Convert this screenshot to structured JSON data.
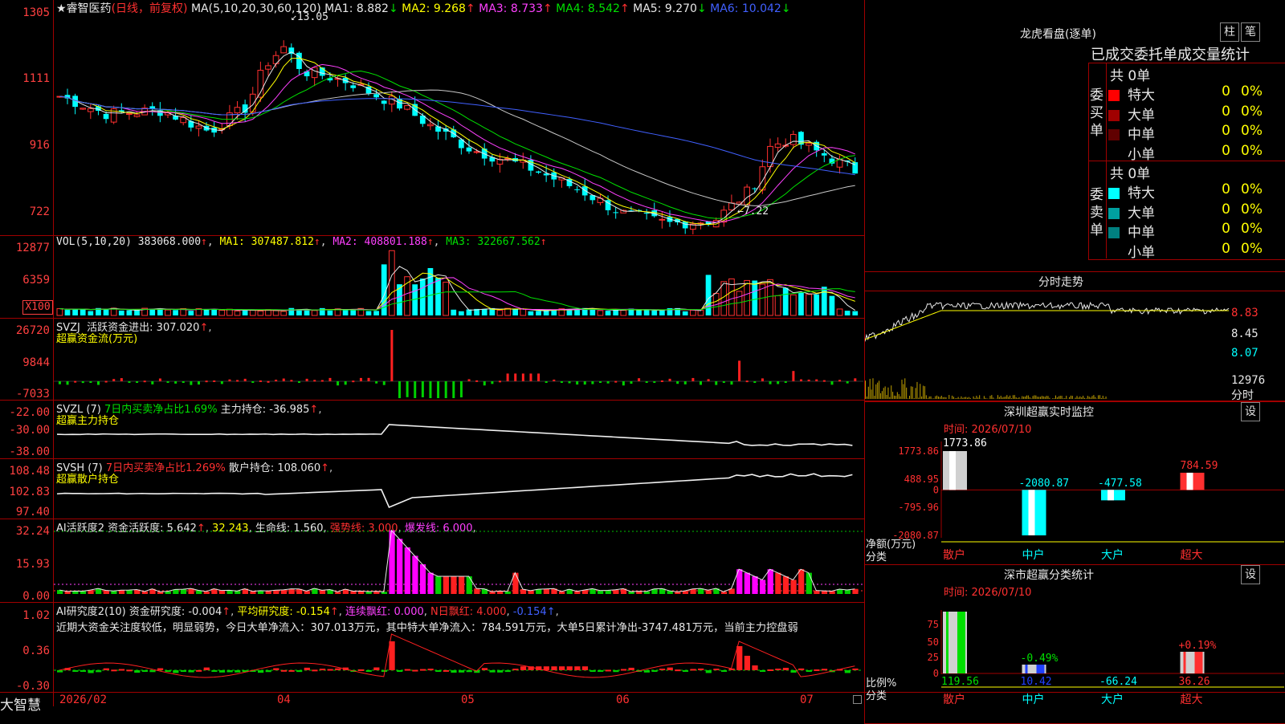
{
  "stock": {
    "name": "睿智医药",
    "mode": "(日线，前复权)",
    "ma_params": "MA(5,10,20,30,60,120)",
    "ma_vals": [
      {
        "label": "MA1: 8.882",
        "arrow": "↓",
        "color": "#e8e8e8"
      },
      {
        "label": "MA2: 9.268",
        "arrow": "↑",
        "color": "#ffff00"
      },
      {
        "label": "MA3: 8.733",
        "arrow": "↑",
        "color": "#ff40ff"
      },
      {
        "label": "MA4: 8.542",
        "arrow": "↑",
        "color": "#00e000"
      },
      {
        "label": "MA5: 9.270",
        "arrow": "↓",
        "color": "#e8e8e8"
      },
      {
        "label": "MA6: 10.042",
        "arrow": "↓",
        "color": "#4060ff"
      }
    ],
    "high_mark": "13.05",
    "low_mark": "7.22"
  },
  "price_axis": [
    "1305",
    "1111",
    "916",
    "722"
  ],
  "vol": {
    "title": "VOL(5,10,20)",
    "value": "383068.000",
    "ma1": "MA1: 307487.812",
    "ma2": "MA2: 408801.188",
    "ma3": "MA3: 322667.562",
    "axis": [
      "12877",
      "6359"
    ],
    "unit": "X100"
  },
  "svzj": {
    "title": "SVZJ",
    "label": "活跃资金进出: 307.020",
    "sub": "超赢资金流(万元)",
    "axis": [
      "26720",
      "9844",
      "-7033"
    ]
  },
  "svzl": {
    "title": "SVZL (7)",
    "label1": "7日内买卖净占比1.69%",
    "label2": "主力持仓: -36.985",
    "sub": "超赢主力持仓",
    "axis": [
      "-22.00",
      "-30.00",
      "-38.00"
    ]
  },
  "svsh": {
    "title": "SVSH (7)",
    "label1": "7日内买卖净占比1.269%",
    "label2": "散户持仓: 108.060",
    "sub": "超赢散户持仓",
    "axis": [
      "108.48",
      "102.83",
      "97.40"
    ]
  },
  "ai1": {
    "title": "AI活跃度2",
    "l1": "资金活跃度: 5.642",
    "l2": "32.243",
    "l3": "生命线: 1.560",
    "l4": "强势线: 3.000",
    "l5": "爆发线: 6.000",
    "axis": [
      "32.24",
      "15.93",
      "0.00"
    ]
  },
  "ai2": {
    "title": "AI研究度2(10)",
    "l1": "资金研究度: -0.004",
    "l2": "平均研究度: -0.154",
    "l3": "连续飘红: 0.000",
    "l4": "N日飘红: 4.000",
    "l5": "-0.154",
    "commentary": "近期大资金关注度较低，明显弱势，今日大单净流入：307.013万元，其中特大单净流入：784.591万元，大单5日累计净出-3747.481万元，当前主力控盘弱",
    "axis": [
      "1.02",
      "0.36",
      "-0.30"
    ]
  },
  "xaxis": [
    "2026/02",
    "04",
    "05",
    "06",
    "07"
  ],
  "brand": "大智慧",
  "longhu": {
    "title": "龙虎看盘(逐单)",
    "btn1": "柱",
    "btn2": "笔",
    "tabs": "已成交委托单成交量统计",
    "buy_label": "委买单",
    "sell_label": "委卖单",
    "buy_total": "共 0单",
    "sell_total": "共 0单",
    "buy_rows": [
      {
        "name": "特大",
        "val": "0",
        "pct": "0%",
        "color": "#ff0000"
      },
      {
        "name": "大单",
        "val": "0",
        "pct": "0%",
        "color": "#a00000"
      },
      {
        "name": "中单",
        "val": "0",
        "pct": "0%",
        "color": "#600000"
      },
      {
        "name": "小单",
        "val": "0",
        "pct": "0%",
        "color": "#000000"
      }
    ],
    "sell_rows": [
      {
        "name": "特大",
        "val": "0",
        "pct": "0%",
        "color": "#00ffff"
      },
      {
        "name": "大单",
        "val": "0",
        "pct": "0%",
        "color": "#00a0a0"
      },
      {
        "name": "中单",
        "val": "0",
        "pct": "0%",
        "color": "#008080"
      },
      {
        "name": "小单",
        "val": "0",
        "pct": "0%",
        "color": "#000000"
      }
    ]
  },
  "intraday": {
    "title": "分时走势",
    "axis": [
      "8.83",
      "8.45",
      "8.07",
      "12976",
      "分时"
    ]
  },
  "monitor": {
    "title": "深圳超赢实时监控",
    "btn": "设",
    "time": "时间: 2026/07/10",
    "axis": [
      "1773.86",
      "488.95",
      "0",
      "-795.96",
      "-2080.87"
    ],
    "unit": "净额(万元)",
    "cat_label": "分类",
    "categories": [
      "散户",
      "中户",
      "大户",
      "超大"
    ],
    "values": [
      "1773.86",
      "-2080.87",
      "-477.58",
      "784.59"
    ]
  },
  "classify": {
    "title": "深市超赢分类统计",
    "btn": "设",
    "time": "时间: 2026/07/10",
    "axis": [
      "75",
      "50",
      "25",
      "0"
    ],
    "unit": "比例%",
    "cat_label": "分类",
    "categories": [
      "散户",
      "中户",
      "大户",
      "超大"
    ],
    "bottom_vals": [
      "119.56",
      "10.42",
      "-66.24",
      "36.26"
    ],
    "top_vals": [
      "",
      "-0.49%",
      "",
      "+0.19%"
    ]
  },
  "chart_data": {
    "type": "candlestick",
    "title": "睿智医药",
    "x_ticks": [
      "2026/02",
      "04",
      "05",
      "06",
      "07"
    ],
    "price_range": [
      7.22,
      13.05
    ],
    "volume_axis": [
      12877,
      6359
    ],
    "monitor_bars": {
      "categories": [
        "散户",
        "中户",
        "大户",
        "超大"
      ],
      "values": [
        1773.86,
        -2080.87,
        -477.58,
        784.59
      ]
    },
    "ratio_bars": {
      "categories": [
        "散户",
        "中户",
        "大户",
        "超大"
      ],
      "values": [
        119.56,
        10.42,
        -66.24,
        36.26
      ]
    }
  }
}
